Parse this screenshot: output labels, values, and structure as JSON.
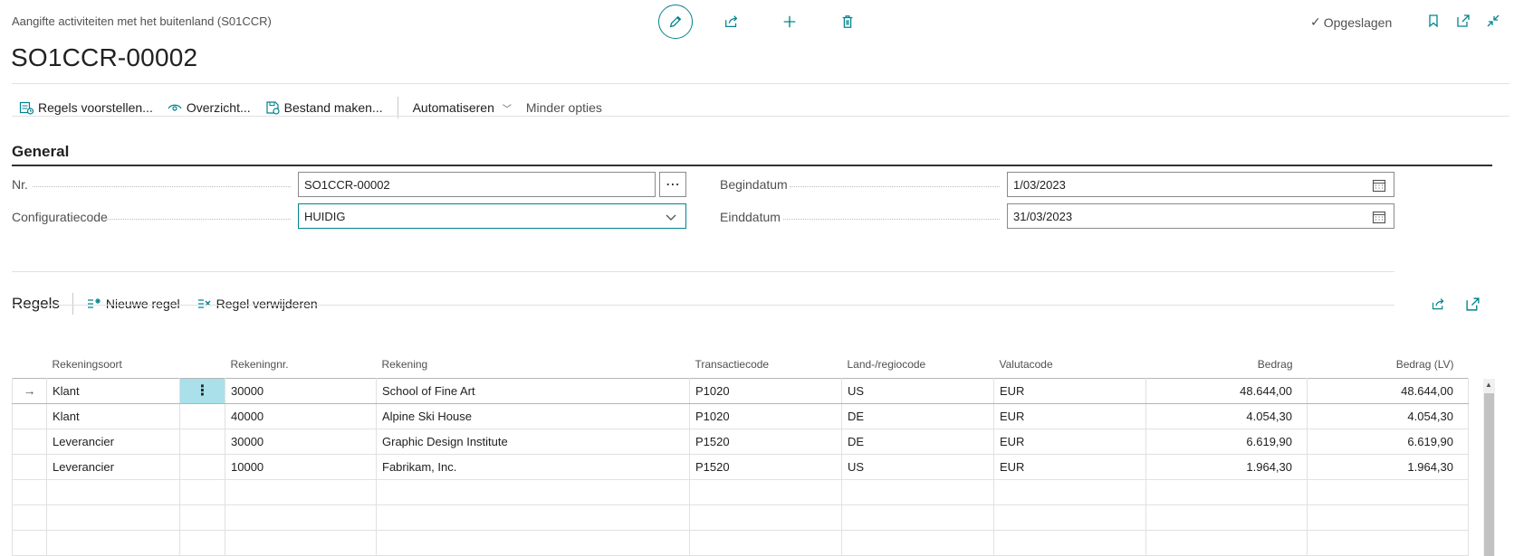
{
  "header": {
    "breadcrumb": "Aangifte activiteiten met het buitenland (S01CCR)",
    "title": "SO1CCR-00002",
    "status": "Opgeslagen"
  },
  "actions": {
    "suggest_lines": "Regels voorstellen...",
    "overview": "Overzicht...",
    "create_file": "Bestand maken...",
    "automate": "Automatiseren",
    "fewer_options": "Minder opties"
  },
  "general": {
    "section_title": "General",
    "nr_label": "Nr.",
    "nr_value": "SO1CCR-00002",
    "config_label": "Configuratiecode",
    "config_value": "HUIDIG",
    "start_label": "Begindatum",
    "start_value": "1/03/2023",
    "end_label": "Einddatum",
    "end_value": "31/03/2023"
  },
  "lines": {
    "title": "Regels",
    "new_line": "Nieuwe regel",
    "delete_line": "Regel verwijderen",
    "columns": [
      "Rekeningsoort",
      "Rekeningnr.",
      "Rekening",
      "Transactiecode",
      "Land-/regiocode",
      "Valutacode",
      "Bedrag",
      "Bedrag (LV)"
    ],
    "rows": [
      [
        "Klant",
        "30000",
        "School of Fine Art",
        "P1020",
        "US",
        "EUR",
        "48.644,00",
        "48.644,00"
      ],
      [
        "Klant",
        "40000",
        "Alpine Ski House",
        "P1020",
        "DE",
        "EUR",
        "4.054,30",
        "4.054,30"
      ],
      [
        "Leverancier",
        "30000",
        "Graphic Design Institute",
        "P1520",
        "DE",
        "EUR",
        "6.619,90",
        "6.619,90"
      ],
      [
        "Leverancier",
        "10000",
        "Fabrikam, Inc.",
        "P1520",
        "US",
        "EUR",
        "1.964,30",
        "1.964,30"
      ]
    ]
  },
  "icons": {
    "edit": "pencil-icon",
    "share": "share-icon",
    "new": "plus-icon",
    "delete": "trash-icon",
    "saved": "check-icon",
    "bookmark": "bookmark-icon",
    "open_new_window": "open-new-window-icon",
    "collapse": "collapse-icon",
    "row_arrow": "→",
    "row_menu": "⋮",
    "assist": "⋯"
  },
  "colors": {
    "accent": "#00848e",
    "selected_cell": "#a9e0e9"
  }
}
